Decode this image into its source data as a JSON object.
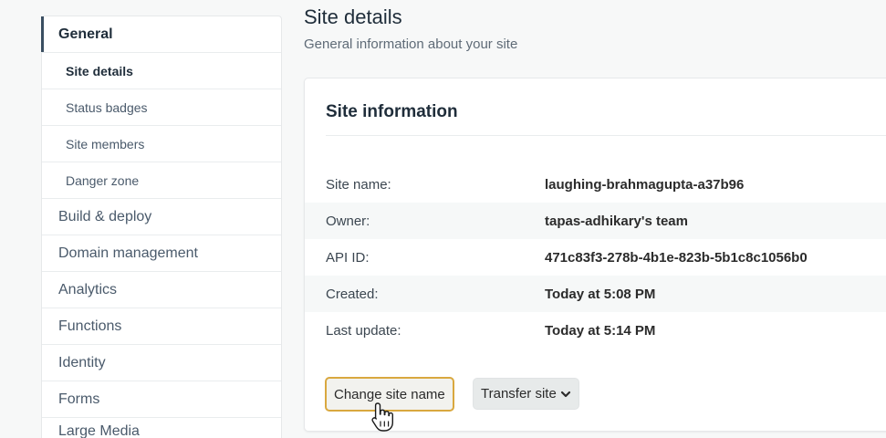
{
  "sidebar": {
    "section_label": "General",
    "sub_items": [
      {
        "label": "Site details"
      },
      {
        "label": "Status badges"
      },
      {
        "label": "Site members"
      },
      {
        "label": "Danger zone"
      }
    ],
    "items": [
      {
        "label": "Build & deploy"
      },
      {
        "label": "Domain management"
      },
      {
        "label": "Analytics"
      },
      {
        "label": "Functions"
      },
      {
        "label": "Identity"
      },
      {
        "label": "Forms"
      },
      {
        "label": "Large Media"
      }
    ]
  },
  "header": {
    "title": "Site details",
    "subtitle": "General information about your site"
  },
  "card": {
    "title": "Site information",
    "rows": [
      {
        "label": "Site name:",
        "value": "laughing-brahmagupta-a37b96"
      },
      {
        "label": "Owner:",
        "value": "tapas-adhikary's team"
      },
      {
        "label": "API ID:",
        "value": "471c83f3-278b-4b1e-823b-5b1c8c1056b0"
      },
      {
        "label": "Created:",
        "value": "Today at 5:08 PM"
      },
      {
        "label": "Last update:",
        "value": "Today at 5:14 PM"
      }
    ],
    "change_name_label": "Change site name",
    "transfer_label": "Transfer site"
  },
  "icons": {
    "dropdown": "chevron-down-icon",
    "cursor": "hand-pointer-icon"
  },
  "colors": {
    "focus_border": "#d9a83f",
    "active_marker": "#3a4e61"
  }
}
